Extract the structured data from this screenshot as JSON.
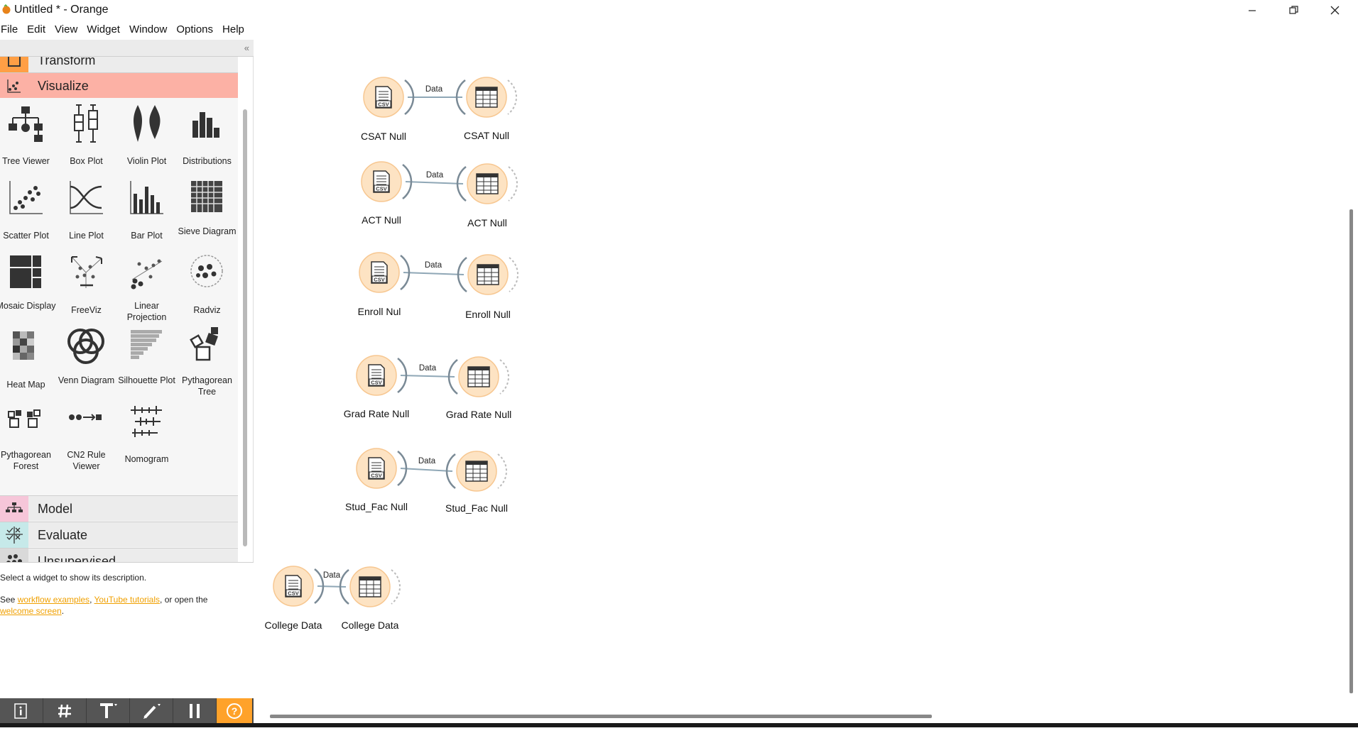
{
  "window": {
    "title": "Untitled * - Orange"
  },
  "menu": [
    "File",
    "Edit",
    "View",
    "Widget",
    "Window",
    "Options",
    "Help"
  ],
  "toolbox": {
    "transform_label": "Transform",
    "visualize_label": "Visualize",
    "widgets": [
      {
        "label": "Tree Viewer",
        "icon": "tree-viewer-icon"
      },
      {
        "label": "Box Plot",
        "icon": "box-plot-icon"
      },
      {
        "label": "Violin Plot",
        "icon": "violin-plot-icon"
      },
      {
        "label": "Distributions",
        "icon": "distributions-icon"
      },
      {
        "label": "Scatter Plot",
        "icon": "scatter-plot-icon"
      },
      {
        "label": "Line Plot",
        "icon": "line-plot-icon"
      },
      {
        "label": "Bar Plot",
        "icon": "bar-plot-icon"
      },
      {
        "label": "Sieve Diagram",
        "icon": "sieve-diagram-icon"
      },
      {
        "label": "Mosaic Display",
        "icon": "mosaic-display-icon"
      },
      {
        "label": "FreeViz",
        "icon": "freeviz-icon"
      },
      {
        "label": "Linear Projection",
        "icon": "linear-projection-icon"
      },
      {
        "label": "Radviz",
        "icon": "radviz-icon"
      },
      {
        "label": "Heat Map",
        "icon": "heat-map-icon"
      },
      {
        "label": "Venn Diagram",
        "icon": "venn-diagram-icon"
      },
      {
        "label": "Silhouette Plot",
        "icon": "silhouette-plot-icon"
      },
      {
        "label": "Pythagorean Tree",
        "icon": "pythagorean-tree-icon"
      },
      {
        "label": "Pythagorean Forest",
        "icon": "pythagorean-forest-icon"
      },
      {
        "label": "CN2 Rule Viewer",
        "icon": "cn2-rule-viewer-icon"
      },
      {
        "label": "Nomogram",
        "icon": "nomogram-icon"
      }
    ],
    "categories": [
      "Model",
      "Evaluate",
      "Unsupervised"
    ],
    "colors": {
      "visualize": "#fcb1a5",
      "model": "#f6c6d9",
      "evaluate": "#c6e9e9",
      "unsupervised": "#d9d9d9"
    }
  },
  "description": {
    "line1": "Select a widget to show its description.",
    "see": "See ",
    "link1": "workflow examples",
    "comma": ", ",
    "link2": "YouTube tutorials",
    "mid": ", or open the ",
    "link3": "welcome screen",
    "end": "."
  },
  "workflow": {
    "link_label": "Data",
    "pairs": [
      {
        "source": "CSAT Null",
        "target": "CSAT Null"
      },
      {
        "source": "ACT Null",
        "target": "ACT Null"
      },
      {
        "source": "Enroll Nul",
        "target": "Enroll Null"
      },
      {
        "source": "Grad Rate Null",
        "target": "Grad Rate Null"
      },
      {
        "source": "Stud_Fac Null",
        "target": "Stud_Fac Null"
      },
      {
        "source": "College Data",
        "target": "College Data"
      }
    ],
    "node_color": "#fde3c3",
    "node_border": "#f7c791"
  },
  "bottom_toolbar": [
    "info-icon",
    "grid-icon",
    "text-icon",
    "pen-icon",
    "pause-icon",
    "help-icon"
  ]
}
